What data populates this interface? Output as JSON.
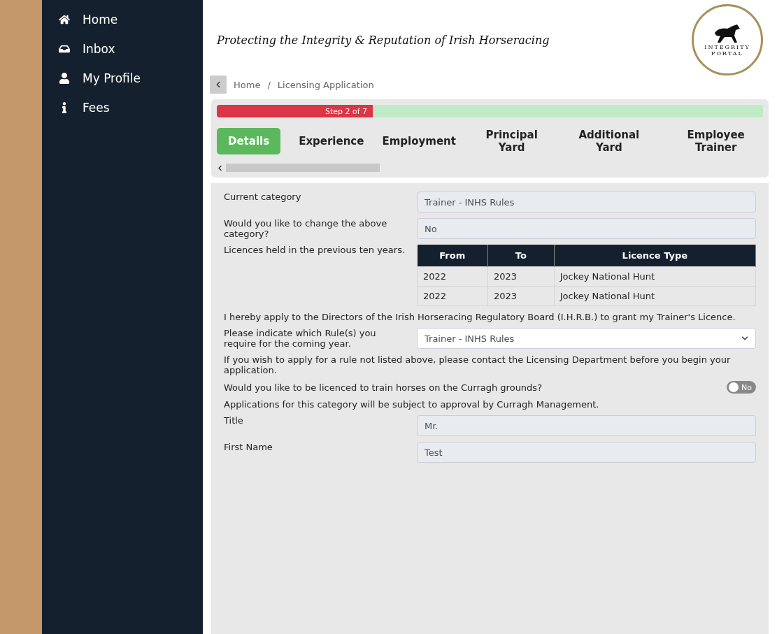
{
  "sidebar": {
    "items": [
      {
        "label": "Home"
      },
      {
        "label": "Inbox"
      },
      {
        "label": "My Profile"
      },
      {
        "label": "Fees"
      }
    ]
  },
  "header": {
    "tagline": "Protecting the Integrity & Reputation of Irish Horseracing",
    "logo_lines": [
      "INTEGRITY",
      "PORTAL"
    ]
  },
  "breadcrumb": {
    "items": [
      "Home",
      "Licensing Application"
    ],
    "separator": "/"
  },
  "progress": {
    "label": "Step 2 of 7",
    "level": 0.2857
  },
  "steps": [
    {
      "label": "Details",
      "selected": true
    },
    {
      "label": "Experience",
      "selected": false
    },
    {
      "label": "Employment",
      "selected": false
    },
    {
      "label": "Principal Yard",
      "selected": false
    },
    {
      "label": "Additional Yard",
      "selected": false
    },
    {
      "label": "Employee Trainer",
      "selected": false
    }
  ],
  "form": {
    "current_category": {
      "label": "Current category",
      "value": "Trainer - INHS Rules"
    },
    "change_category": {
      "label": "Would you like to change the above category?",
      "value": "No"
    },
    "licences": {
      "label": "Licences held in the previous ten years.",
      "columns": [
        "From",
        "To",
        "Licence Type"
      ],
      "rows": [
        [
          "2022",
          "2023",
          "Jockey National Hunt"
        ],
        [
          "2022",
          "2023",
          "Jockey National Hunt"
        ]
      ]
    },
    "declaration": "I hereby apply to the Directors of the Irish Horseracing Regulatory Board (I.H.R.B.) to grant my Trainer's Licence.",
    "rules": {
      "label": "Please indicate which Rule(s) you require for the coming year.",
      "value": "Trainer - INHS Rules"
    },
    "rules_note": "If you wish to apply for a rule not listed above, please contact the Licensing Department before you begin your application.",
    "curragh": {
      "label": "Would you like to be licenced to train horses on the Curragh grounds?",
      "on": false,
      "toggle_text": "No"
    },
    "curragh_note": "Applications for this category will be subject to approval by Curragh Management.",
    "title": {
      "label": "Title",
      "value": "Mr."
    },
    "first_name": {
      "label": "First Name",
      "value": "Test"
    }
  }
}
